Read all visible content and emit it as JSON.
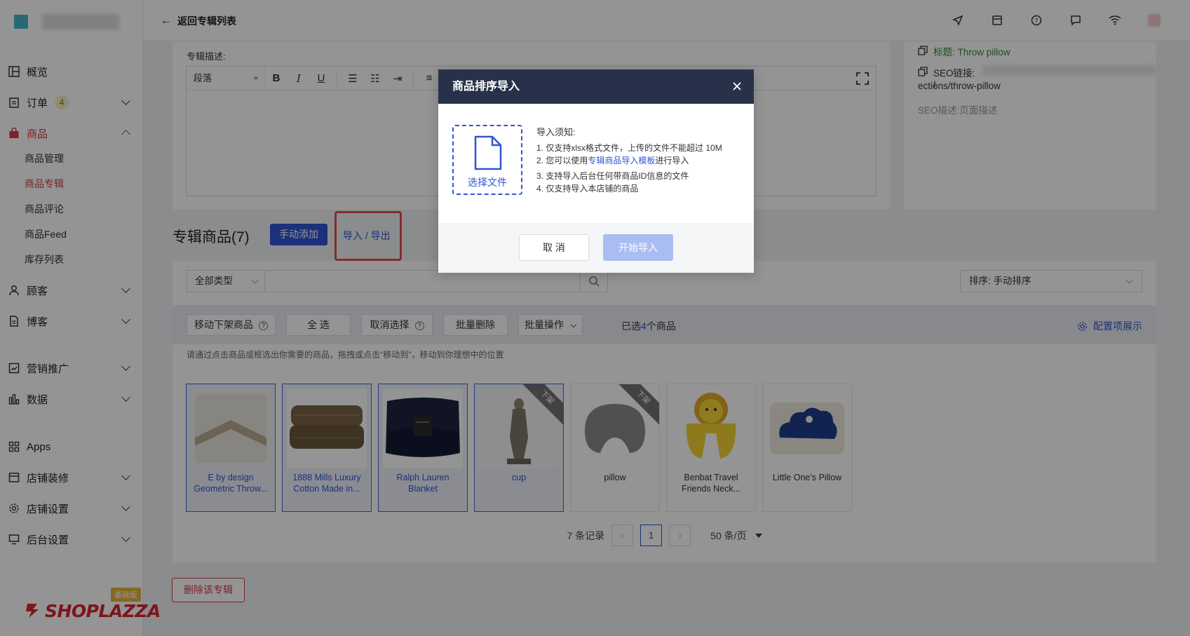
{
  "header": {
    "back_label": "返回专辑列表"
  },
  "sidebar": {
    "items": [
      {
        "label": "概览"
      },
      {
        "label": "订单",
        "badge": "4"
      },
      {
        "label": "商品"
      },
      {
        "label": "顾客"
      },
      {
        "label": "博客"
      },
      {
        "label": "营销推广"
      },
      {
        "label": "数据"
      },
      {
        "label": "Apps"
      },
      {
        "label": "店铺装修"
      },
      {
        "label": "店铺设置"
      },
      {
        "label": "后台设置"
      }
    ],
    "sub_items": [
      "商品管理",
      "商品专辑",
      "商品评论",
      "商品Feed",
      "库存列表"
    ],
    "brand": "SHOPLAZZA",
    "plan_badge": "基础版"
  },
  "editor": {
    "label": "专辑描述:",
    "paragraph_select": "段落"
  },
  "seo": {
    "title_line": "标题: Throw pillow",
    "link_label": "SEO链接: I",
    "link_value": "ections/throw-pillow",
    "desc_line": "SEO描述:页面描述"
  },
  "products_section": {
    "title": "专辑商品(7)",
    "manual_add": "手动添加",
    "import_export": "导入 / 导出",
    "type_filter": "全部类型",
    "sort": "排序: 手动排序",
    "bulk": {
      "move_off": "移动下架商品",
      "select_all": "全 选",
      "deselect": "取消选择",
      "batch_delete": "批量删除",
      "batch_ops": "批量操作",
      "selected_prefix": "已选",
      "selected_count": "4",
      "selected_suffix": "个商品",
      "config": "配置项展示"
    },
    "hint": "请通过点击商品或框选出你需要的商品，拖拽或点击\"移动到\"，移动到你理想中的位置",
    "items": [
      {
        "name": "E by design Geometric Throw..."
      },
      {
        "name": "1888 Mills Luxury Cotton Made in..."
      },
      {
        "name": "Ralph Lauren Blanket"
      },
      {
        "name": "cup",
        "ribbon": "下架"
      },
      {
        "name": "pillow",
        "ribbon": "下架"
      },
      {
        "name": "Benbat Travel Friends Neck..."
      },
      {
        "name": "Little One's Pillow"
      }
    ],
    "pager": {
      "total": "7 条记录",
      "current": "1",
      "per_page": "50 条/页"
    }
  },
  "delete_album": "删除该专辑",
  "modal": {
    "title": "商品排序导入",
    "upload_label": "选择文件",
    "notes_title": "导入须知:",
    "note1": "1. 仅支持xlsx格式文件，上传的文件不能超过 10M",
    "note2_prefix": "2. 您可以使用",
    "note2_link": "专辑商品导入模板",
    "note2_suffix": "进行导入",
    "note3": "3. 支持导入后台任何带商品ID信息的文件",
    "note4": "4. 仅支持导入本店铺的商品",
    "cancel": "取 消",
    "start": "开始导入"
  }
}
